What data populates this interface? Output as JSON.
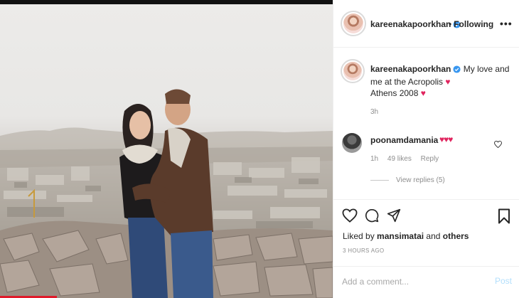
{
  "header": {
    "username": "kareenakapoorkhan",
    "separator": "•",
    "follow_status": "Following",
    "more": "•••"
  },
  "caption": {
    "username": "kareenakapoorkhan",
    "text_line1": "My love and me at the Acropolis",
    "text_line2": "Athens 2008",
    "time": "3h"
  },
  "comment": {
    "username": "poonamdamania",
    "likes": "49 likes",
    "time": "1h",
    "reply": "Reply",
    "view_replies": "View replies (5)"
  },
  "actions": {
    "liked_by_prefix": "Liked by",
    "liked_by_user": "mansimatai",
    "liked_by_and": "and",
    "liked_by_others": "others",
    "posted": "3 HOURS AGO"
  },
  "add_comment": {
    "placeholder": "Add a comment...",
    "post_label": "Post"
  },
  "colors": {
    "verified": "#3897f0",
    "heart": "#e0245e",
    "post_button_disabled": "#b2dffc"
  },
  "icons": [
    "verified-badge-icon",
    "heart-emoji-icon",
    "like-heart-icon",
    "comment-icon",
    "share-icon",
    "save-bookmark-icon"
  ]
}
